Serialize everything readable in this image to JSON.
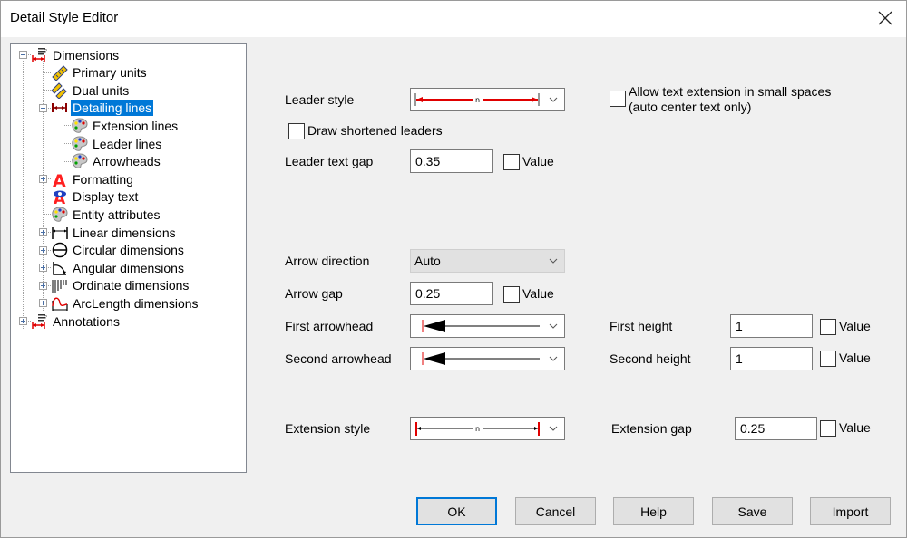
{
  "window": {
    "title": "Detail Style Editor",
    "close_icon": "close-icon"
  },
  "tree": {
    "items": [
      {
        "label": "Dimensions",
        "icon": "dimension-style-icon",
        "level": 0,
        "expander": "minus"
      },
      {
        "label": "Primary units",
        "icon": "ruler-icon",
        "level": 1,
        "expander": null
      },
      {
        "label": "Dual units",
        "icon": "dual-ruler-icon",
        "level": 1,
        "expander": null
      },
      {
        "label": "Detailing lines",
        "icon": "detailing-line-icon",
        "level": 1,
        "expander": "minus",
        "selected": true
      },
      {
        "label": "Extension lines",
        "icon": "palette-icon",
        "level": 2,
        "expander": null
      },
      {
        "label": "Leader lines",
        "icon": "palette-icon",
        "level": 2,
        "expander": null
      },
      {
        "label": "Arrowheads",
        "icon": "palette-icon",
        "level": 2,
        "expander": null
      },
      {
        "label": "Formatting",
        "icon": "text-format-icon",
        "level": 1,
        "expander": "plus"
      },
      {
        "label": "Display text",
        "icon": "display-text-icon",
        "level": 1,
        "expander": null
      },
      {
        "label": "Entity attributes",
        "icon": "palette-icon",
        "level": 1,
        "expander": null
      },
      {
        "label": "Linear dimensions",
        "icon": "linear-dimension-icon",
        "level": 1,
        "expander": "plus"
      },
      {
        "label": "Circular dimensions",
        "icon": "circular-dimension-icon",
        "level": 1,
        "expander": "plus"
      },
      {
        "label": "Angular dimensions",
        "icon": "angular-dimension-icon",
        "level": 1,
        "expander": "plus"
      },
      {
        "label": "Ordinate dimensions",
        "icon": "ordinate-dimension-icon",
        "level": 1,
        "expander": "plus"
      },
      {
        "label": "ArcLength dimensions",
        "icon": "arclength-dimension-icon",
        "level": 1,
        "expander": "plus"
      },
      {
        "label": "Annotations",
        "icon": "dimension-style-icon",
        "level": 0,
        "expander": "plus"
      }
    ]
  },
  "form": {
    "leader_style": {
      "label": "Leader style",
      "preview": "red double-arrow line with text gap"
    },
    "allow_text_extension": {
      "label_line1": "Allow text extension in small spaces",
      "label_line2": "(auto center text only)",
      "checked": false
    },
    "draw_shortened_leaders": {
      "label": "Draw shortened leaders",
      "checked": false
    },
    "leader_text_gap": {
      "label": "Leader text gap",
      "value": "0.35",
      "value_checkbox_label": "Value",
      "value_checked": false
    },
    "arrow_direction": {
      "label": "Arrow direction",
      "value": "Auto"
    },
    "arrow_gap": {
      "label": "Arrow gap",
      "value": "0.25",
      "value_checkbox_label": "Value",
      "value_checked": false
    },
    "first_arrowhead": {
      "label": "First arrowhead",
      "preview": "filled arrowhead"
    },
    "second_arrowhead": {
      "label": "Second arrowhead",
      "preview": "filled arrowhead"
    },
    "first_height": {
      "label": "First height",
      "value": "1",
      "value_checkbox_label": "Value",
      "value_checked": false
    },
    "second_height": {
      "label": "Second height",
      "value": "1",
      "value_checkbox_label": "Value",
      "value_checked": false
    },
    "extension_style": {
      "label": "Extension style",
      "preview": "black line with red end ticks"
    },
    "extension_gap": {
      "label": "Extension gap",
      "value": "0.25",
      "value_checkbox_label": "Value",
      "value_checked": false
    }
  },
  "buttons": {
    "ok": "OK",
    "cancel": "Cancel",
    "help": "Help",
    "save": "Save",
    "import": "Import"
  },
  "colors": {
    "selection": "#0078d7",
    "leader_red": "#e00000"
  }
}
